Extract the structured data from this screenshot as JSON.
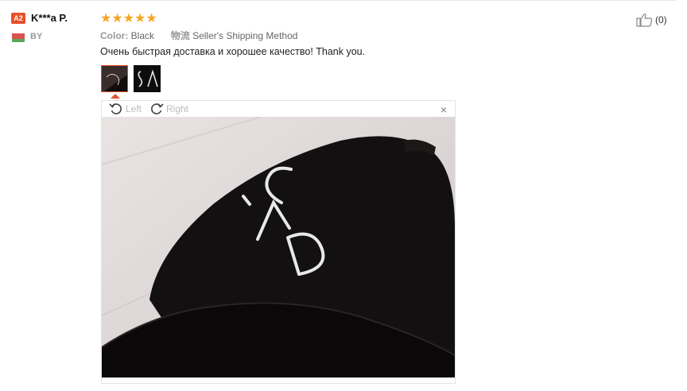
{
  "reviewer": {
    "badge": "A2",
    "name": "K***a P.",
    "country": "BY"
  },
  "rating": {
    "stars": 5,
    "max": 5,
    "star_glyphs": "★★★★★"
  },
  "attributes": {
    "color_label": "Color:",
    "color_value": "Black",
    "shipping_label": "物流",
    "shipping_value": "Seller's Shipping Method"
  },
  "feedback_text": "Очень быстрая доставка и хорошее качество! Thank you.",
  "viewer": {
    "rotate_left": "Left",
    "rotate_right": "Right",
    "close": "×"
  },
  "helpful": {
    "count": "(0)"
  },
  "colors": {
    "accent": "#e8502a",
    "star": "#f5a623"
  },
  "icons": [
    "rotate-left-icon",
    "rotate-right-icon",
    "close-icon",
    "thumbs-up-icon",
    "belarus-flag-icon"
  ]
}
